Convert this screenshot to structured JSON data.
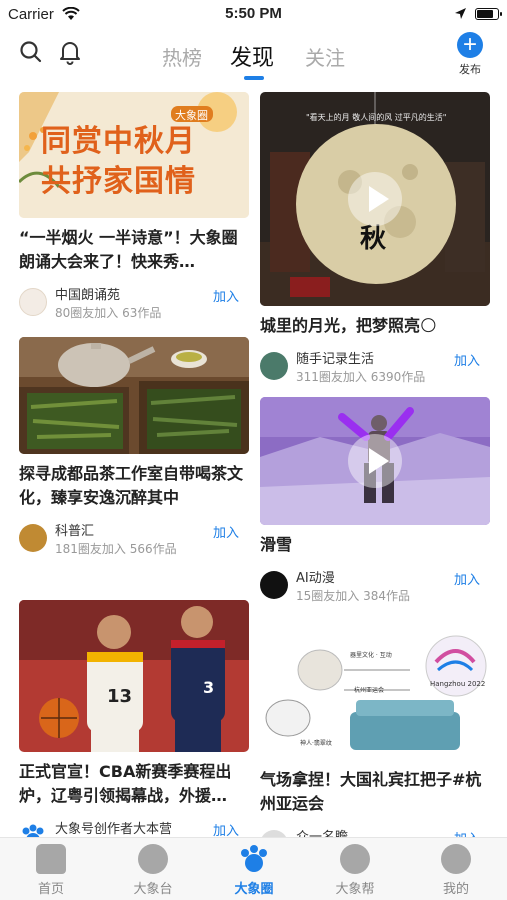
{
  "status": {
    "carrier": "Carrier",
    "time": "5:50 PM"
  },
  "header": {
    "tabs": [
      {
        "label": "热榜"
      },
      {
        "label": "发现"
      },
      {
        "label": "关注"
      }
    ],
    "publish_label": "发布"
  },
  "feed": {
    "left": [
      {
        "image_caption": "同赏中秋月 共抒家国情",
        "image_tag": "大象圈",
        "title": "“一半烟火 一半诗意”！大象圈朗诵大会来了！快来秀…",
        "author": "中国朗诵苑",
        "stats": "80圈友加入 63作品",
        "join": "加入"
      },
      {
        "title": "探寻成都品茶工作室自带喝茶文化，臻享安逸沉醉其中",
        "author": "科普汇",
        "stats": "181圈友加入 566作品",
        "join": "加入"
      },
      {
        "title": "正式官宣！CBA新赛季赛程出炉，辽粤引领揭幕战，外援…",
        "author": "大象号创作者大本营",
        "join": "加入",
        "jersey_a": "13",
        "jersey_b": "3"
      }
    ],
    "right": [
      {
        "image_caption": "\"看天上的月 敬人间的风 过平凡的生活\"",
        "image_char": "秋",
        "title": "城里的月光，把梦照亮🌕",
        "author": "随手记录生活",
        "stats": "311圈友加入 6390作品",
        "join": "加入"
      },
      {
        "title": "滑雪",
        "author": "AI动漫",
        "stats": "15圈友加入 384作品",
        "join": "加入"
      },
      {
        "title": "气场拿捏！大国礼宾扛把子#杭州亚运会",
        "logo_text": "Hangzhou 2022",
        "label_a": "器里文化 · 互动",
        "label_b": "杭州亚运会",
        "label_c": "神人·翡翠纹",
        "author_partial": "众一名瞻",
        "join": "加入"
      }
    ]
  },
  "tabbar": {
    "items": [
      {
        "label": "首页"
      },
      {
        "label": "大象台"
      },
      {
        "label": "大象圈"
      },
      {
        "label": "大象帮"
      },
      {
        "label": "我的"
      }
    ],
    "active_index": 2
  },
  "colors": {
    "accent": "#1e7fe6",
    "muted": "#999999",
    "tab_inactive": "#aaaaaa"
  }
}
